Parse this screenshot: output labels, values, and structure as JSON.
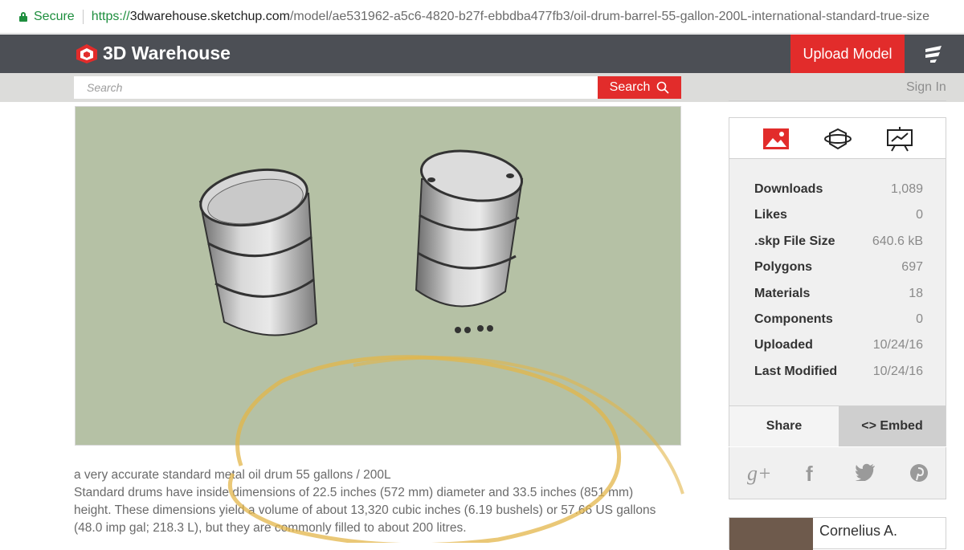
{
  "browser": {
    "secure_label": "Secure",
    "url_scheme": "https://",
    "url_host": "3dwarehouse.sketchup.com",
    "url_path": "/model/ae531962-a5c6-4820-b27f-ebbdba477fb3/oil-drum-barrel-55-gallon-200L-international-standard-true-size"
  },
  "header": {
    "logo_text": "3D Warehouse",
    "upload_label": "Upload Model",
    "menu_icon": "menu-icon"
  },
  "search": {
    "placeholder": "Search",
    "button_label": "Search",
    "signin_label": "Sign In"
  },
  "description": {
    "line1": "a very accurate standard metal oil drum 55 gallons / 200L",
    "line2": "Standard drums have inside dimensions of 22.5 inches (572 mm) diameter and 33.5 inches (851 mm)",
    "line3": "height. These dimensions yield a volume of about 13,320 cubic inches (6.19 bushels) or 57.66 US gallons",
    "line4": "(48.0 imp gal; 218.3 L), but they are commonly filled to about 200 litres."
  },
  "panel": {
    "icons": [
      "image-icon",
      "rotate-3d-icon",
      "presentation-icon"
    ],
    "stats": [
      {
        "label": "Downloads",
        "value": "1,089"
      },
      {
        "label": "Likes",
        "value": "0"
      },
      {
        "label": ".skp File Size",
        "value": "640.6 kB"
      },
      {
        "label": "Polygons",
        "value": "697"
      },
      {
        "label": "Materials",
        "value": "18"
      },
      {
        "label": "Components",
        "value": "0"
      },
      {
        "label": "Uploaded",
        "value": "10/24/16"
      },
      {
        "label": "Last Modified",
        "value": "10/24/16"
      }
    ],
    "share_label": "Share",
    "embed_label": "<> Embed",
    "social": [
      "g+",
      "f",
      "twitter",
      "pinterest"
    ]
  },
  "author": {
    "name": "Cornelius A."
  },
  "colors": {
    "brand_red": "#e22c2b",
    "topbar": "#4c4f55",
    "viewer_bg": "#b5c1a5"
  }
}
